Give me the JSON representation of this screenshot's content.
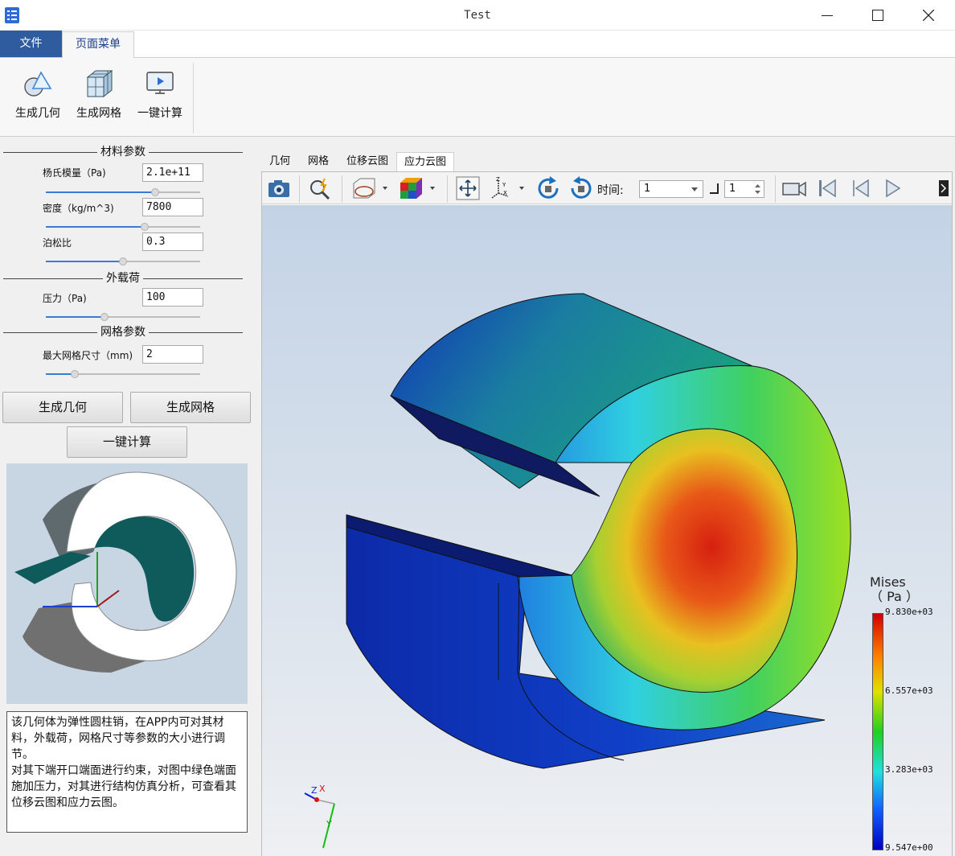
{
  "window": {
    "title": "Test"
  },
  "menu": {
    "file": "文件",
    "page_menu": "页面菜单"
  },
  "ribbon": {
    "buttons": [
      {
        "label": "生成几何",
        "icon": "geometry-icon"
      },
      {
        "label": "生成网格",
        "icon": "mesh-icon"
      },
      {
        "label": "一键计算",
        "icon": "compute-icon"
      }
    ]
  },
  "left": {
    "sections": {
      "material": "材料参数",
      "load": "外载荷",
      "mesh": "网格参数"
    },
    "params": [
      {
        "label": "杨氏模量（Pa)",
        "value": "2.1e+11",
        "slider": 0.71
      },
      {
        "label": "密度（kg/m^3)",
        "value": "7800",
        "slider": 0.64
      },
      {
        "label": "泊松比",
        "value": "0.3",
        "slider": 0.5
      },
      {
        "label": "压力（Pa)",
        "value": "100",
        "slider": 0.38
      },
      {
        "label": "最大网格尺寸（mm)",
        "value": "2",
        "slider": 0.19
      }
    ],
    "buttons": {
      "geometry": "生成几何",
      "mesh": "生成网格",
      "compute": "一键计算"
    },
    "description": [
      "该几何体为弹性圆柱销，在APP内可对其材料，外载荷，网格尺寸等参数的大小进行调节。",
      "对其下端开口端面进行约束，对图中绿色端面施加压力，对其进行结构仿真分析，可查看其位移云图和应力云图。"
    ]
  },
  "view_tabs": [
    "几何",
    "网格",
    "位移云图",
    "应力云图"
  ],
  "active_tab": "应力云图",
  "toolbar": {
    "time_label": "时间:",
    "time_value": "1",
    "step_value": "1"
  },
  "legend": {
    "title_line1": "Mises",
    "title_line2": "（ Pa ）",
    "ticks": [
      "9.830e+03",
      "6.557e+03",
      "3.283e+03",
      "9.547e+00"
    ]
  },
  "axes": {
    "z": "Z",
    "x": "X",
    "y": "Y"
  },
  "colors": {
    "accent": "#2e5c9e",
    "max": "#d00000",
    "min": "#0000c0"
  }
}
